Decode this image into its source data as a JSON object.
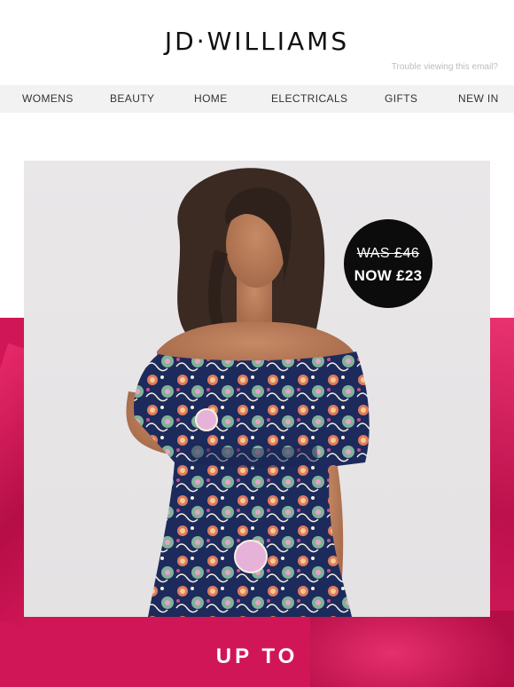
{
  "header": {
    "logo_text": "JD·WILLIAMS",
    "trouble_text": "Trouble viewing this email?"
  },
  "nav": {
    "items": [
      {
        "label": "WOMENS"
      },
      {
        "label": "BEAUTY"
      },
      {
        "label": "HOME"
      },
      {
        "label": "ELECTRICALS"
      },
      {
        "label": "GIFTS"
      },
      {
        "label": "NEW IN"
      }
    ]
  },
  "hero": {
    "image_subject": "model-in-off-shoulder-paisley-print-dress",
    "price_badge": {
      "was": "WAS £46",
      "now": "NOW £23"
    }
  },
  "promo": {
    "headline": "UP TO"
  },
  "colors": {
    "accent_pink": "#d01656",
    "badge_black": "#0c0c0c",
    "nav_bg": "#f2f2f2"
  }
}
